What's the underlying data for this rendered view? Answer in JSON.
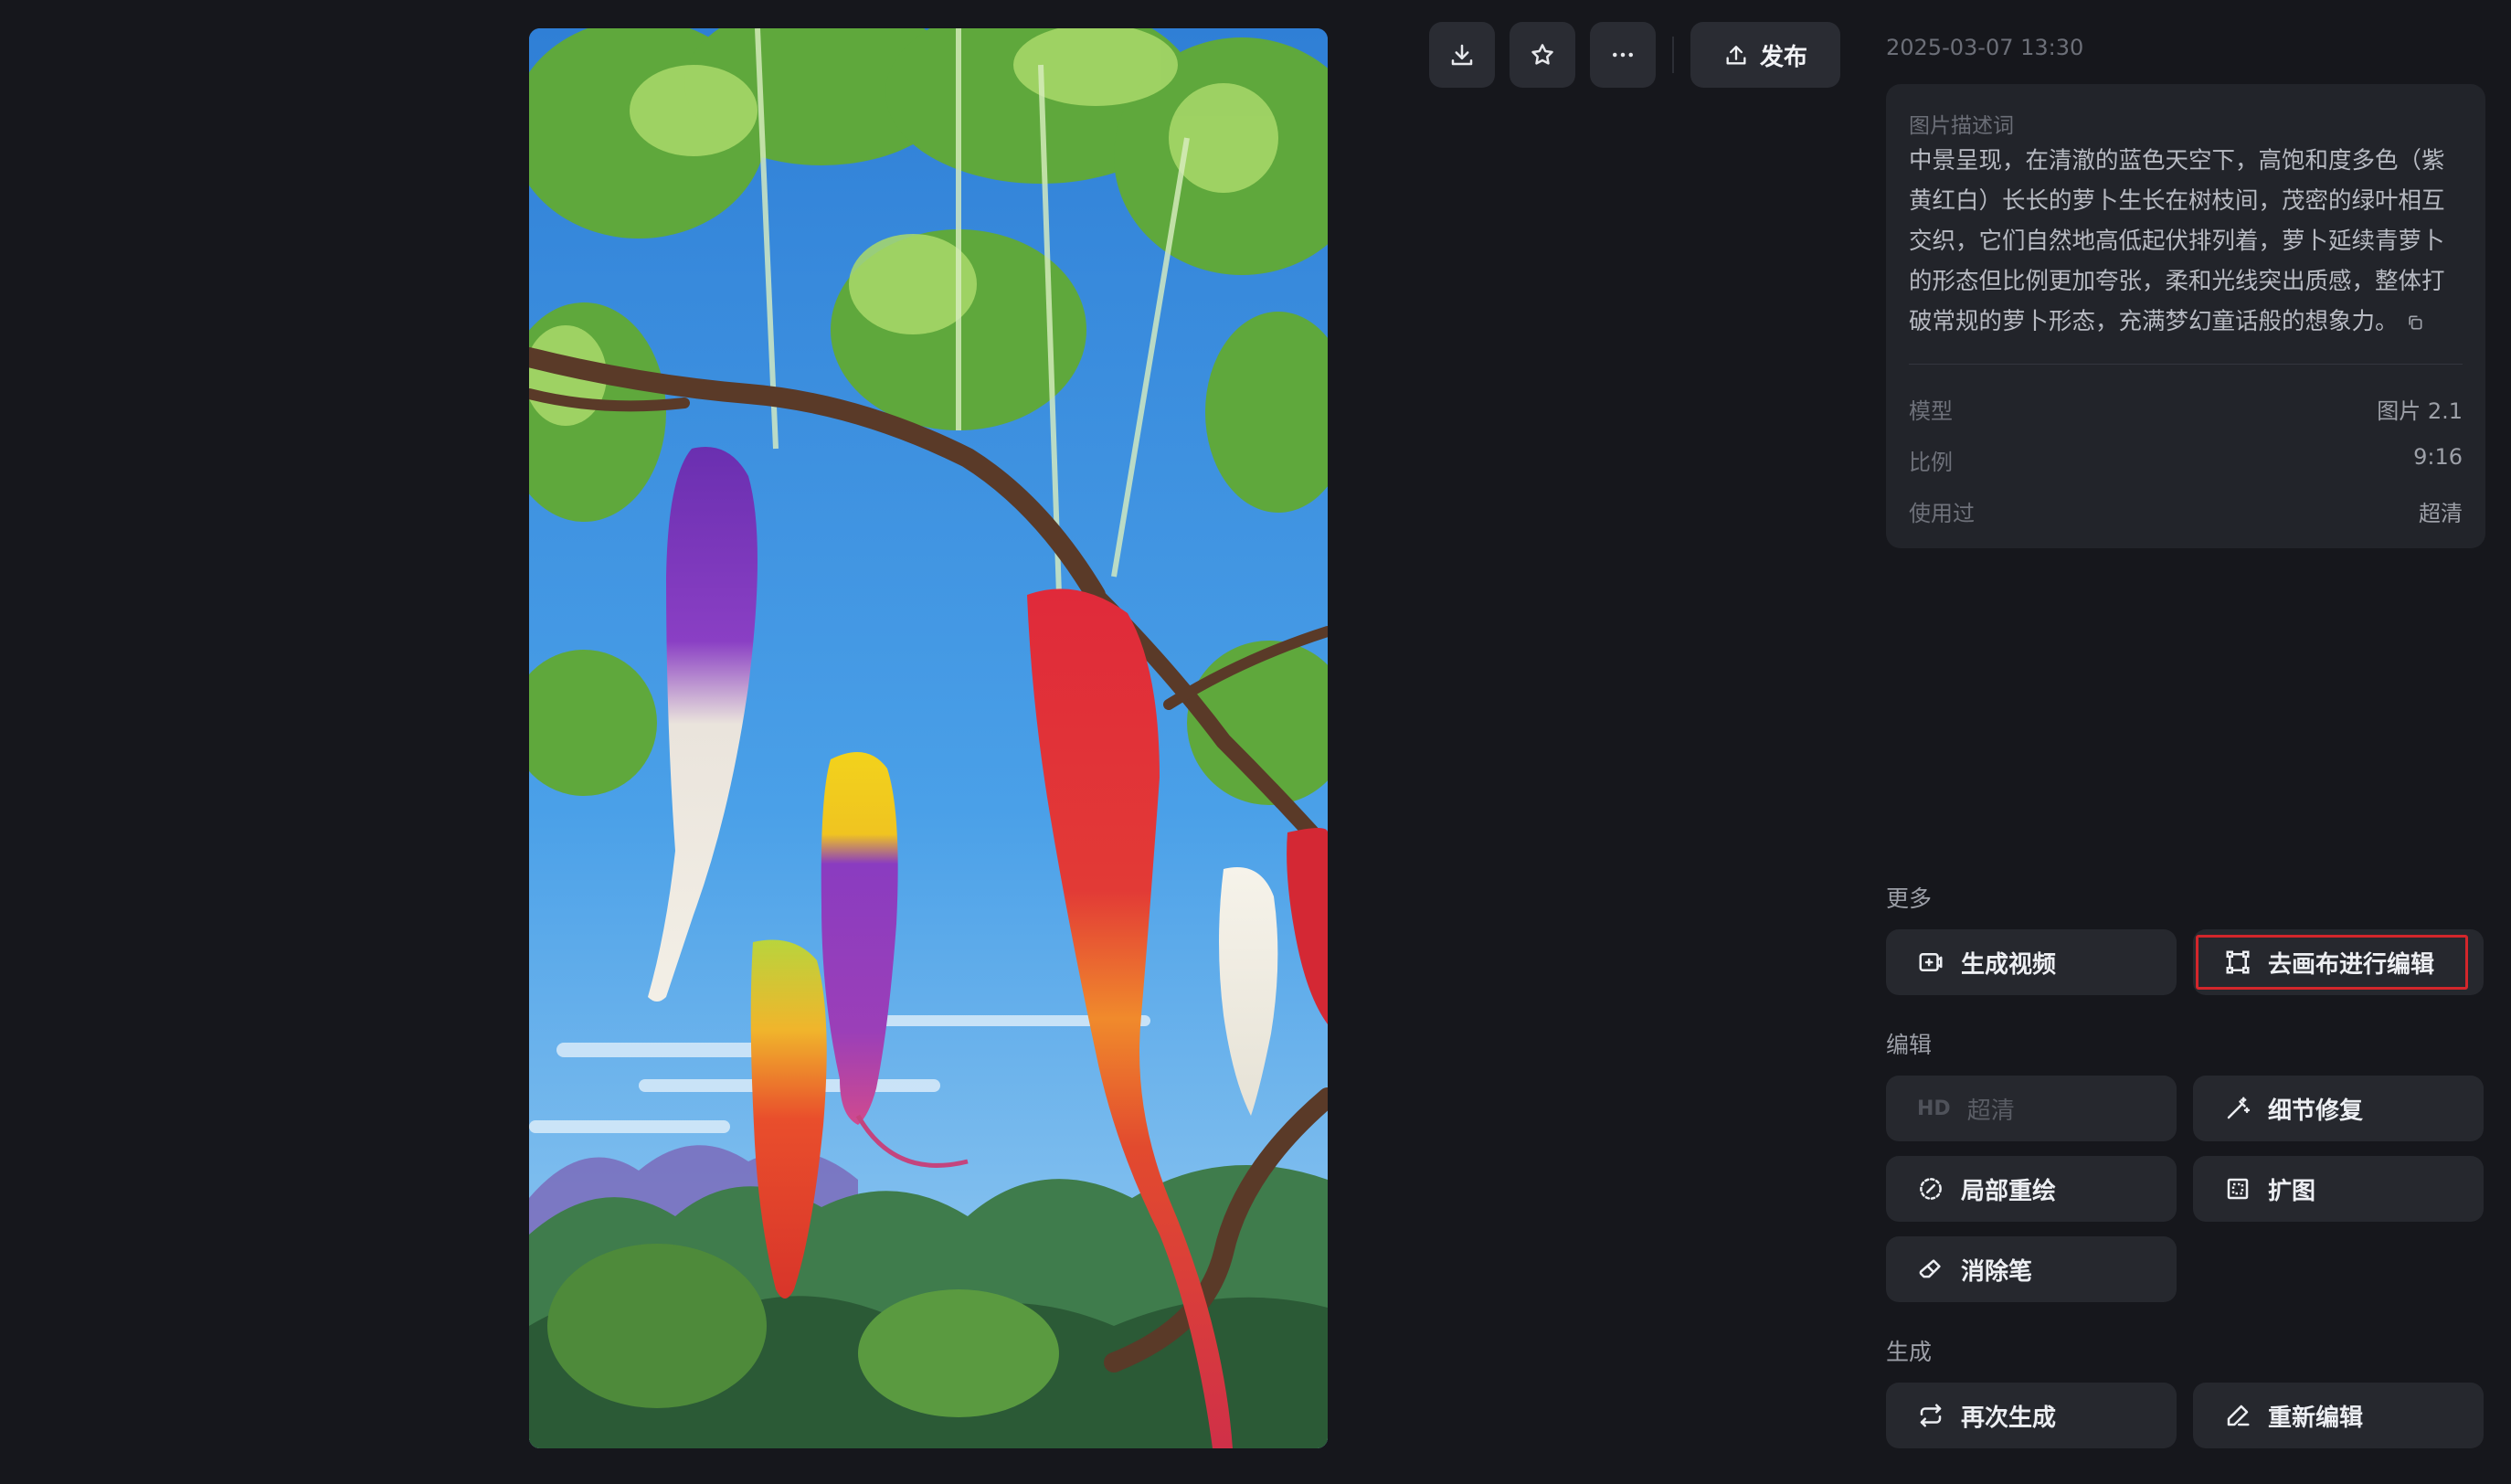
{
  "toolbar": {
    "download_icon": "download-icon",
    "favorite_icon": "star-icon",
    "more_icon": "more-icon",
    "publish_label": "发布"
  },
  "detail": {
    "timestamp": "2025-03-07 13:30",
    "description_label": "图片描述词",
    "description": "中景呈现，在清澈的蓝色天空下，高饱和度多色（紫黄红白）长长的萝卜生长在树枝间，茂密的绿叶相互交织，它们自然地高低起伏排列着，萝卜延续青萝卜的形态但比例更加夸张，柔和光线突出质感，整体打破常规的萝卜形态，充满梦幻童话般的想象力。",
    "meta": [
      {
        "key": "模型",
        "value": "图片 2.1"
      },
      {
        "key": "比例",
        "value": "9:16"
      },
      {
        "key": "使用过",
        "value": "超清"
      }
    ]
  },
  "sections": {
    "more": {
      "title": "更多",
      "generate_video": "生成视频",
      "edit_on_canvas": "去画布进行编辑"
    },
    "edit": {
      "title": "编辑",
      "hd_badge": "HD",
      "upscale": "超清",
      "detail_fix": "细节修复",
      "inpaint": "局部重绘",
      "outpaint": "扩图",
      "eraser": "消除笔"
    },
    "generate": {
      "title": "生成",
      "regenerate": "再次生成",
      "re_edit": "重新编辑"
    }
  },
  "colors": {
    "background": "#16171c",
    "card": "#22242a",
    "button": "#26282e",
    "highlight": "#d3262b"
  }
}
